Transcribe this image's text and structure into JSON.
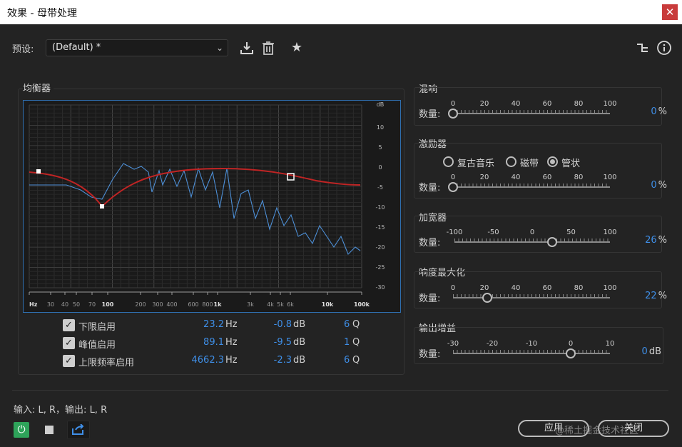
{
  "window": {
    "title": "效果 - 母带处理",
    "close_glyph": "✕"
  },
  "preset": {
    "label": "预设:",
    "value": "(Default) *"
  },
  "toolbar_icons": [
    "download-icon",
    "trash-icon",
    "star-icon",
    "routing-icon",
    "info-icon"
  ],
  "equalizer": {
    "title": "均衡器",
    "freq_ticks": [
      "Hz",
      "30",
      "40",
      "50",
      "70",
      "100",
      "200",
      "300",
      "400",
      "600",
      "800",
      "1k",
      "3k",
      "4k",
      "5k",
      "6k",
      "10k",
      "100k"
    ],
    "db_ticks": [
      "dB",
      "10",
      "5",
      "0",
      "-5",
      "-10",
      "-15",
      "-20",
      "-25",
      "-30"
    ],
    "bands": [
      {
        "label": "下限启用",
        "enabled": true,
        "freq": "23.2",
        "freq_unit": "Hz",
        "gain": "-0.8",
        "gain_unit": "dB",
        "q": "6",
        "q_unit": "Q"
      },
      {
        "label": "峰值启用",
        "enabled": true,
        "freq": "89.1",
        "freq_unit": "Hz",
        "gain": "-9.5",
        "gain_unit": "dB",
        "q": "1",
        "q_unit": "Q"
      },
      {
        "label": "上限频率启用",
        "enabled": true,
        "freq": "4662.3",
        "freq_unit": "Hz",
        "gain": "-2.3",
        "gain_unit": "dB",
        "q": "6",
        "q_unit": "Q"
      }
    ],
    "check_glyph": "✓"
  },
  "reverb": {
    "title": "混响",
    "amount_label": "数量:",
    "ticks": [
      "0",
      "20",
      "40",
      "60",
      "80",
      "100"
    ],
    "value": "0",
    "unit": "%",
    "level": 0
  },
  "exciter": {
    "title": "激励器",
    "modes": [
      {
        "label": "复古音乐",
        "selected": false
      },
      {
        "label": "磁带",
        "selected": false
      },
      {
        "label": "管状",
        "selected": true
      }
    ],
    "amount_label": "数量:",
    "ticks": [
      "0",
      "20",
      "40",
      "60",
      "80",
      "100"
    ],
    "value": "0",
    "unit": "%",
    "level": 0
  },
  "widener": {
    "title": "加宽器",
    "amount_label": "数量:",
    "ticks": [
      "-100",
      "-50",
      "0",
      "50",
      "100"
    ],
    "value": "26",
    "unit": "%",
    "level": 26
  },
  "loudness": {
    "title": "响度最大化",
    "amount_label": "数量:",
    "ticks": [
      "0",
      "20",
      "40",
      "60",
      "80",
      "100"
    ],
    "value": "22",
    "unit": "%",
    "level": 22
  },
  "output_gain": {
    "title": "输出增益",
    "amount_label": "数量:",
    "ticks": [
      "-30",
      "-20",
      "-10",
      "0",
      "10"
    ],
    "value": "0",
    "unit": "dB",
    "level": 0
  },
  "footer": {
    "io_text": "输入: L, R，输出: L, R",
    "apply_label": "应用",
    "close_label": "关闭",
    "watermark": "@稀土掘金技术社区"
  },
  "colors": {
    "accent": "#3f8fe8",
    "eq_curve": "#c02424",
    "spectrum": "#4d8fd6",
    "power": "#2ea35a",
    "graph_border": "#2f6fb0"
  }
}
